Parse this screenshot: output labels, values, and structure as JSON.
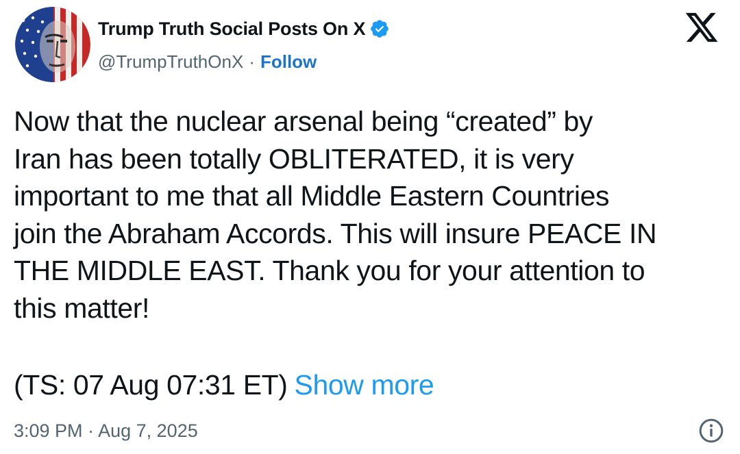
{
  "account": {
    "display_name": "Trump Truth Social Posts On X",
    "handle": "@TrumpTruthOnX",
    "separator": "·",
    "follow_label": "Follow",
    "verified_icon": "verified-badge-icon",
    "avatar_icon": "flag-portrait-avatar"
  },
  "platform": {
    "logo_icon": "x-logo-icon"
  },
  "post": {
    "text": "Now that the nuclear arsenal being “created” by\nIran has been totally OBLITERATED, it is very\nimportant to me that all Middle Eastern Countries\njoin the Abraham Accords. This will insure PEACE IN\nTHE MIDDLE EAST. Thank you for your attention to\nthis matter!",
    "timestamp_note": "(TS: 07 Aug 07:31 ET)",
    "show_more_label": "Show more"
  },
  "meta": {
    "time": "3:09 PM",
    "separator": "·",
    "date": "Aug 7, 2025",
    "info_icon": "info-circle-icon"
  },
  "colors": {
    "text_primary": "#0f1419",
    "text_secondary": "#536471",
    "link_blue": "#1d9bf0",
    "follow_blue": "#1d73c9",
    "verified_blue": "#1d9bf0"
  }
}
